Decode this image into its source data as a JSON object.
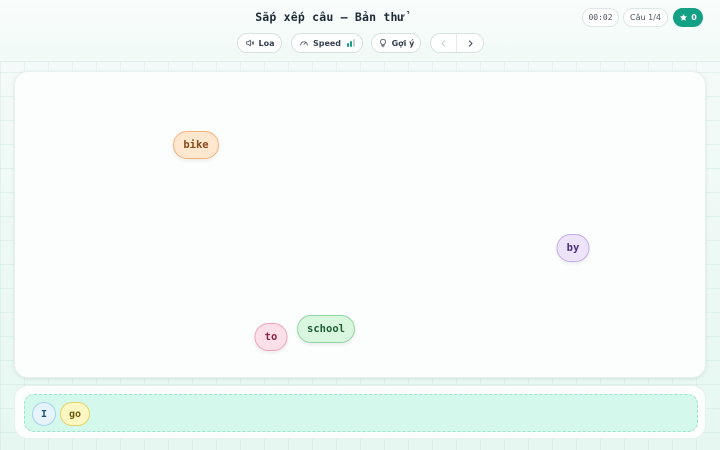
{
  "header": {
    "title": "Sắp xếp câu — Bản thử",
    "timer": "00:02",
    "counter": "Câu 1/4",
    "stars": "0"
  },
  "toolbar": {
    "speaker_label": "Loa",
    "speed_label": "Speed",
    "speed_level": 2,
    "speed_max": 3,
    "hint_label": "Gợi ý"
  },
  "scattered_words": [
    {
      "text": "bike",
      "bg": "#fde7cf",
      "border": "#f2b27a",
      "color": "#8a4a1b"
    },
    {
      "text": "by",
      "bg": "#ede4fb",
      "border": "#c4a9ee",
      "color": "#4c2c7c"
    },
    {
      "text": "to",
      "bg": "#fbe0ea",
      "border": "#efa3bd",
      "color": "#8a2347"
    },
    {
      "text": "school",
      "bg": "#d9f6df",
      "border": "#8fd7a1",
      "color": "#1e5f33"
    }
  ],
  "placed_words": [
    {
      "text": "I",
      "bg": "#e6f3fb",
      "border": "#a8d2ec",
      "color": "#1f4f6c"
    },
    {
      "text": "go",
      "bg": "#fdf7c4",
      "border": "#e6d36a",
      "color": "#6b5a08"
    }
  ],
  "colors": {
    "accent": "#14a085"
  }
}
